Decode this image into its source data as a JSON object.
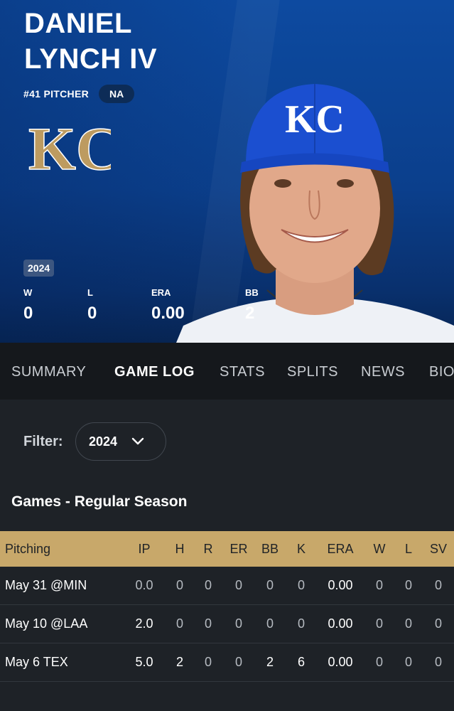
{
  "player": {
    "first_name": "DANIEL",
    "last_name": "LYNCH IV",
    "position": "#41 PITCHER",
    "tag": "NA",
    "team_logo_text": "KC",
    "cap_logo_text": "KC"
  },
  "season_summary": {
    "season": "2024",
    "stats": [
      {
        "label": "W",
        "value": "0"
      },
      {
        "label": "L",
        "value": "0"
      },
      {
        "label": "ERA",
        "value": "0.00"
      },
      {
        "label": "BB",
        "value": "2"
      }
    ]
  },
  "tabs": [
    {
      "label": "SUMMARY",
      "active": false
    },
    {
      "label": "GAME LOG",
      "active": true
    },
    {
      "label": "STATS",
      "active": false
    },
    {
      "label": "SPLITS",
      "active": false
    },
    {
      "label": "NEWS",
      "active": false
    },
    {
      "label": "BIO",
      "active": false
    }
  ],
  "filter": {
    "label": "Filter:",
    "value": "2024",
    "icon": "chevron-down-icon"
  },
  "section_title": "Games - Regular Season",
  "table": {
    "headers": [
      "Pitching",
      "IP",
      "H",
      "R",
      "ER",
      "BB",
      "K",
      "ERA",
      "W",
      "L",
      "SV"
    ],
    "rows": [
      [
        "May 31 @MIN",
        "0.0",
        "0",
        "0",
        "0",
        "0",
        "0",
        "0.00",
        "0",
        "0",
        "0"
      ],
      [
        "May 10 @LAA",
        "2.0",
        "0",
        "0",
        "0",
        "0",
        "0",
        "0.00",
        "0",
        "0",
        "0"
      ],
      [
        "May 6 TEX",
        "5.0",
        "2",
        "0",
        "0",
        "2",
        "6",
        "0.00",
        "0",
        "0",
        "0"
      ]
    ]
  },
  "colors": {
    "hero_blue": "#0b3f8c",
    "cap_blue": "#1b4fd0",
    "logo_gold": "#bd9b60",
    "table_header_gold": "#c8a86a",
    "background": "#1e2227"
  }
}
